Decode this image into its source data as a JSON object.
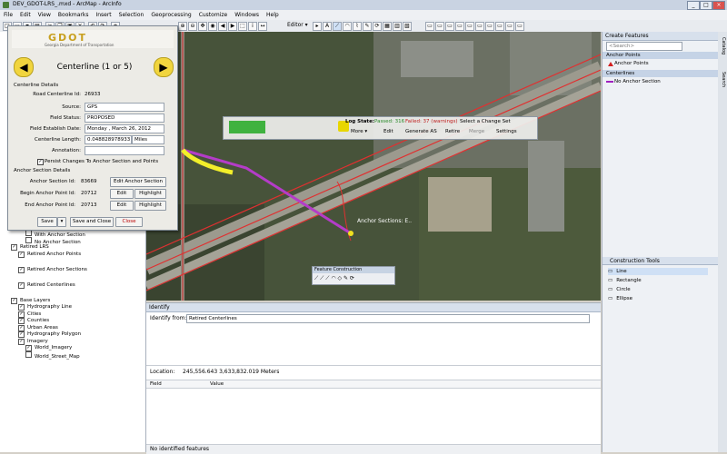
{
  "window": {
    "title": "DEV_GDOT-LRS_.mxd - ArcMap - ArcInfo",
    "buttons": [
      "_",
      "□",
      "×"
    ]
  },
  "menu": [
    "File",
    "Edit",
    "View",
    "Bookmarks",
    "Insert",
    "Selection",
    "Geoprocessing",
    "Customize",
    "Windows",
    "Help"
  ],
  "toolbar": {
    "editor_label": "Editor ▾"
  },
  "dialog": {
    "header_logo": "GDOT",
    "header_subtitle": "Georgia Department of Transportation",
    "title": "Centerline (1 or 5)",
    "section1": "Centerline Details",
    "road_id_label": "Road Centerline Id:",
    "road_id_value": "26933",
    "source_label": "Source:",
    "source_value": "GPS",
    "status_label": "Field Status:",
    "status_value": "PROPOSED",
    "date_label": "Field Establish Date:",
    "date_value": "Monday ,  March  26, 2012",
    "length_label": "Centerline Length:",
    "length_value": "0.048828978933",
    "length_unit": "Miles",
    "annotation_label": "Annotation:",
    "annotation_value": "",
    "persist_label": "Persist Changes To Anchor Section and Points",
    "section2": "Anchor Section Details",
    "anchor_id_label": "Anchor Section Id:",
    "anchor_id_value": "83669",
    "edit_anchor_btn": "Edit Anchor Section",
    "begin_label": "Begin Anchor Point Id:",
    "begin_value": "20712",
    "end_label": "End Anchor Point Id:",
    "end_value": "20713",
    "edit_btn": "Edit",
    "highlight_btn": "Highlight",
    "save_btn": "Save",
    "save_close_btn": "Save and Close",
    "close_btn": "Close"
  },
  "toc": {
    "items": [
      {
        "label": "With Anchor Section",
        "indent": 3,
        "check": false
      },
      {
        "label": "No Anchor Section",
        "indent": 3,
        "check": false
      },
      {
        "label": "Retired LRS",
        "indent": 1,
        "check": true
      },
      {
        "label": "Retired Anchor Points",
        "indent": 2,
        "check": true
      },
      {
        "label": "Retired Anchor Sections",
        "indent": 2,
        "check": true
      },
      {
        "label": "Retired Centerlines",
        "indent": 2,
        "check": true
      },
      {
        "label": "Base Layers",
        "indent": 1,
        "check": true
      },
      {
        "label": "Hydrography Line",
        "indent": 2,
        "check": true
      },
      {
        "label": "Cities",
        "indent": 2,
        "check": true
      },
      {
        "label": "Counties",
        "indent": 2,
        "check": true
      },
      {
        "label": "Urban Areas",
        "indent": 2,
        "check": true
      },
      {
        "label": "Hydrography Polygon",
        "indent": 2,
        "check": true
      },
      {
        "label": "Imagery",
        "indent": 2,
        "check": true
      },
      {
        "label": "World_Imagery",
        "indent": 3,
        "check": true
      },
      {
        "label": "World_Street_Map",
        "indent": 3,
        "check": false
      }
    ]
  },
  "logbar": {
    "state_label": "Log State:",
    "passed": "Passed: 316",
    "failed": "Failed: 37 (warnings)",
    "change_set": "Select a Change Set",
    "more": "More ▾",
    "edit": "Edit",
    "generate": "Generate AS",
    "retire": "Retire",
    "merge": "Merge",
    "settings": "Settings"
  },
  "map": {
    "anchor_label": "Anchor Sections: E.."
  },
  "feature_construction": {
    "title": "Feature Construction"
  },
  "create_features": {
    "title": "Create Features",
    "search_placeholder": "<Search>",
    "group1": "Anchor Points",
    "item1": "Anchor Points",
    "group2": "Centerlines",
    "item2": "No Anchor Section"
  },
  "construction_tools": {
    "title": "Construction Tools",
    "tools": [
      "Line",
      "Rectangle",
      "Circle",
      "Ellipse"
    ]
  },
  "side_tabs": [
    "Catalog",
    "Search"
  ],
  "identify": {
    "title": "Identify",
    "from_label": "Identify from:",
    "from_value": "Retired Centerlines",
    "location_label": "Location:",
    "location_value": "245,556.643  3,633,832.019 Meters",
    "col_field": "Field",
    "col_value": "Value",
    "status": "No identified features"
  }
}
